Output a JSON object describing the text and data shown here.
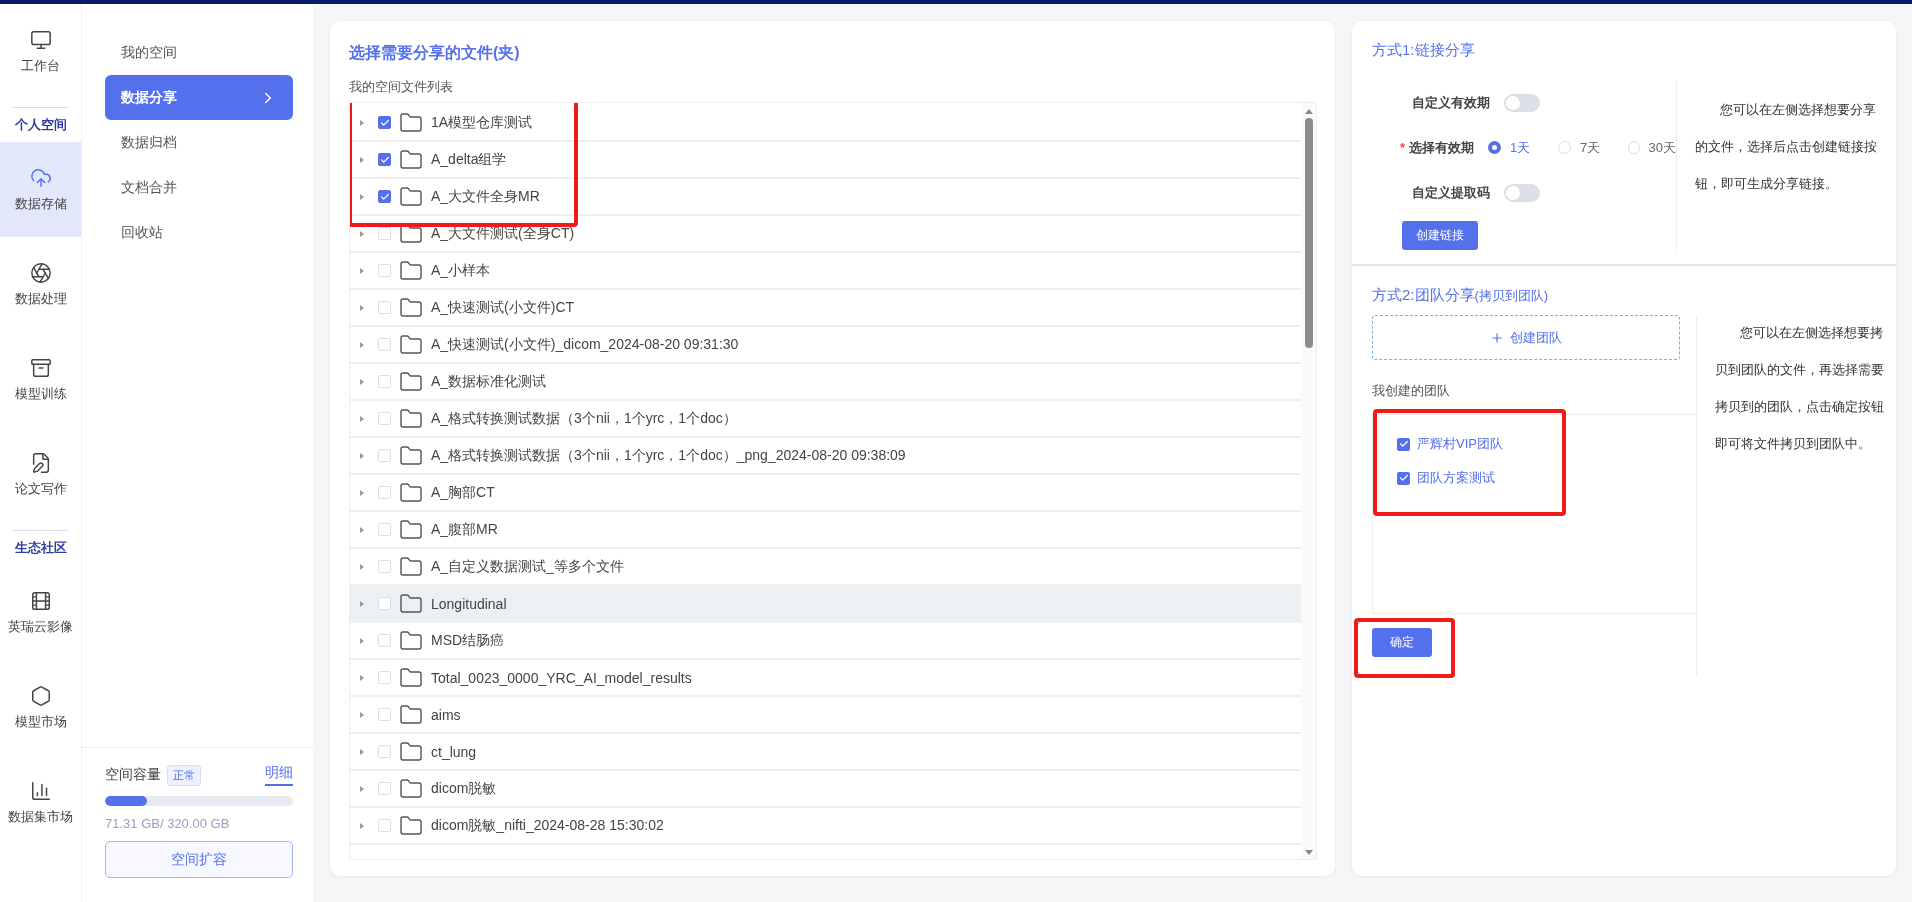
{
  "nav": {
    "items": [
      {
        "kind": "item",
        "label": "工作台",
        "selected": false
      },
      {
        "kind": "section",
        "label": "个人空间"
      },
      {
        "kind": "item",
        "label": "数据存储",
        "selected": true
      },
      {
        "kind": "item",
        "label": "数据处理",
        "selected": false
      },
      {
        "kind": "item",
        "label": "模型训练",
        "selected": false
      },
      {
        "kind": "item",
        "label": "论文写作",
        "selected": false
      },
      {
        "kind": "section",
        "label": "生态社区"
      },
      {
        "kind": "item",
        "label": "英瑞云影像",
        "selected": false
      },
      {
        "kind": "item",
        "label": "模型市场",
        "selected": false
      },
      {
        "kind": "item",
        "label": "数据集市场",
        "selected": false
      }
    ]
  },
  "submenu": {
    "items": [
      {
        "label": "我的空间",
        "selected": false
      },
      {
        "label": "数据分享",
        "selected": true
      },
      {
        "label": "数据归档",
        "selected": false
      },
      {
        "label": "文档合并",
        "selected": false
      },
      {
        "label": "回收站",
        "selected": false
      }
    ]
  },
  "storage": {
    "label": "空间容量",
    "badge": "正常",
    "link": "明细",
    "level": 0.223,
    "usage": "71.31 GB/ 320.00 GB",
    "button": "空间扩容"
  },
  "file_panel": {
    "title": "选择需要分享的文件(夹)",
    "list_label": "我的空间文件列表",
    "red_frame": true,
    "rows": [
      {
        "name": "1A模型仓库测试",
        "checked": true,
        "hovered": false
      },
      {
        "name": "A_delta组学",
        "checked": true,
        "hovered": false
      },
      {
        "name": "A_大文件全身MR",
        "checked": true,
        "hovered": false
      },
      {
        "name": "A_大文件测试(全身CT)",
        "checked": false,
        "hovered": false
      },
      {
        "name": "A_小样本",
        "checked": false,
        "hovered": false
      },
      {
        "name": "A_快速测试(小文件)CT",
        "checked": false,
        "hovered": false
      },
      {
        "name": "A_快速测试(小文件)_dicom_2024-08-20 09:31:30",
        "checked": false,
        "hovered": false
      },
      {
        "name": "A_数据标准化测试",
        "checked": false,
        "hovered": false
      },
      {
        "name": "A_格式转换测试数据（3个nii，1个yrc，1个doc）",
        "checked": false,
        "hovered": false
      },
      {
        "name": "A_格式转换测试数据（3个nii，1个yrc，1个doc）_png_2024-08-20 09:38:09",
        "checked": false,
        "hovered": false
      },
      {
        "name": "A_胸部CT",
        "checked": false,
        "hovered": false
      },
      {
        "name": "A_腹部MR",
        "checked": false,
        "hovered": false
      },
      {
        "name": "A_自定义数据测试_等多个文件",
        "checked": false,
        "hovered": false
      },
      {
        "name": "Longitudinal",
        "checked": false,
        "hovered": true
      },
      {
        "name": "MSD结肠癌",
        "checked": false,
        "hovered": false
      },
      {
        "name": "Total_0023_0000_YRC_AI_model_results",
        "checked": false,
        "hovered": false
      },
      {
        "name": "aims",
        "checked": false,
        "hovered": false
      },
      {
        "name": "ct_lung",
        "checked": false,
        "hovered": false
      },
      {
        "name": "dicom脱敏",
        "checked": false,
        "hovered": false
      },
      {
        "name": "dicom脱敏_nifti_2024-08-28 15:30:02",
        "checked": false,
        "hovered": false
      }
    ]
  },
  "link_share": {
    "title": "方式1:链接分享",
    "toggles": [
      {
        "label": "自定义有效期",
        "on": false
      },
      {
        "label": "自定义提取码",
        "on": false
      }
    ],
    "period": {
      "label": "选择有效期",
      "required_mark": "*",
      "options": [
        {
          "label": "1天",
          "selected": true
        },
        {
          "label": "7天",
          "selected": false
        },
        {
          "label": "30天",
          "selected": false
        }
      ]
    },
    "button": "创建链接",
    "help": "您可以在左侧选择想要分享的文件，选择后点击创建链接按钮，即可生成分享链接。"
  },
  "team_share": {
    "title": "方式2:团队分享",
    "subtitle": "(拷贝到团队)",
    "create_button": "创建团队",
    "list_label": "我创建的团队",
    "teams_red_frame": true,
    "confirm_red_frame": true,
    "teams": [
      {
        "name": "严辉村VIP团队",
        "checked": true
      },
      {
        "name": "团队方案测试",
        "checked": true
      }
    ],
    "confirm": "确定",
    "help": "您可以在左侧选择想要拷贝到团队的文件，再选择需要拷贝到的团队，点击确定按钮即可将文件拷贝到团队中。"
  }
}
